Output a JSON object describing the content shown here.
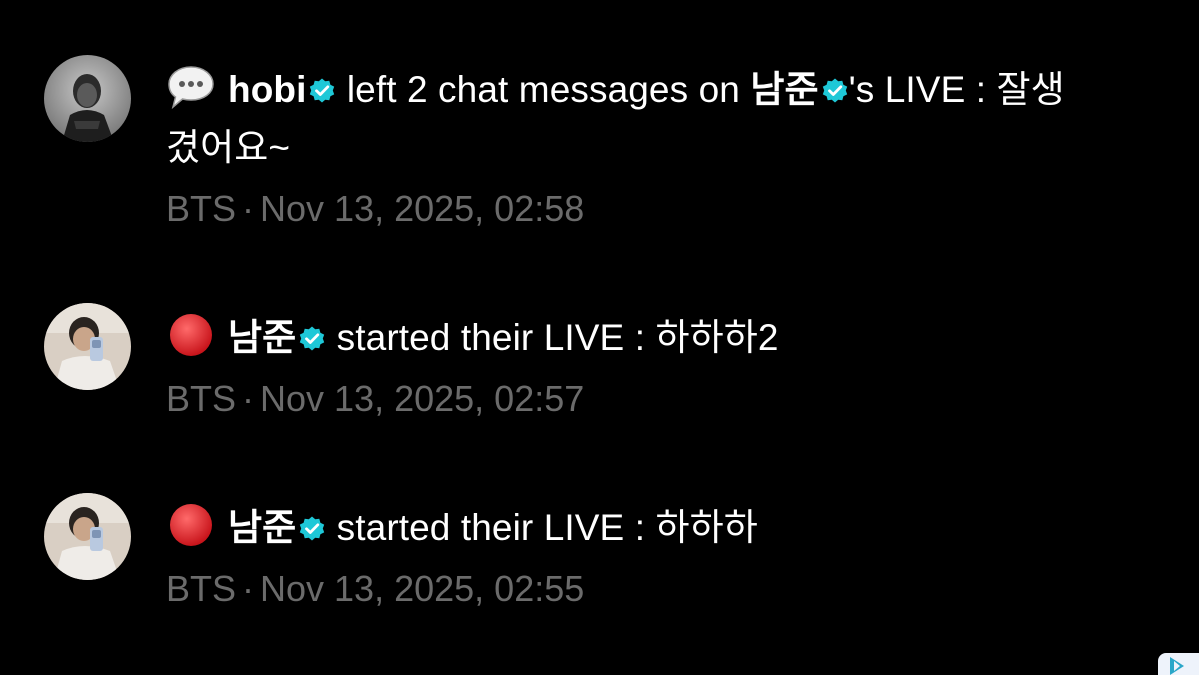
{
  "feed": {
    "items": [
      {
        "type": "chat",
        "emoji": "speech-balloon",
        "actor": "hobi",
        "text": " left 2 chat messages on ",
        "target": "남준",
        "text2": "'s LIVE : 잘생",
        "text3": "겼어요~",
        "group": "BTS",
        "separator": "·",
        "timestamp": "Nov 13, 2025, 02:58"
      },
      {
        "type": "live",
        "emoji": "red-circle",
        "actor": "남준",
        "text": " started their LIVE : 하하하2",
        "group": "BTS",
        "separator": "·",
        "timestamp": "Nov 13, 2025, 02:57"
      },
      {
        "type": "live",
        "emoji": "red-circle",
        "actor": "남준",
        "text": " started their LIVE : 하하하",
        "group": "BTS",
        "separator": "·",
        "timestamp": "Nov 13, 2025, 02:55"
      }
    ]
  },
  "colors": {
    "background": "#000000",
    "text": "#ffffff",
    "meta": "#6b6b6b",
    "verified": "#1ec8d7",
    "live_red": "#e0242b"
  }
}
